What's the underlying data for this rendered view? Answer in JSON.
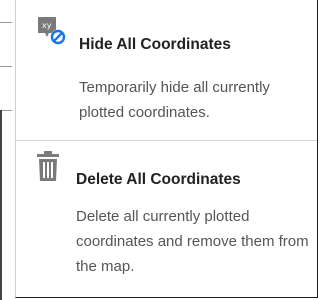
{
  "menu": {
    "items": [
      {
        "icon": "hide-coordinates-icon",
        "title": "Hide All Coordinates",
        "description": "Temporarily hide all currently plotted coordinates."
      },
      {
        "icon": "trash-icon",
        "title": "Delete All Coordinates",
        "description": "Delete all currently plotted coordinates and remove them from the map."
      }
    ]
  },
  "colors": {
    "accent": "#1a73e8",
    "icon_gray": "#7a7a7a",
    "title": "#222222",
    "description": "#555555"
  }
}
